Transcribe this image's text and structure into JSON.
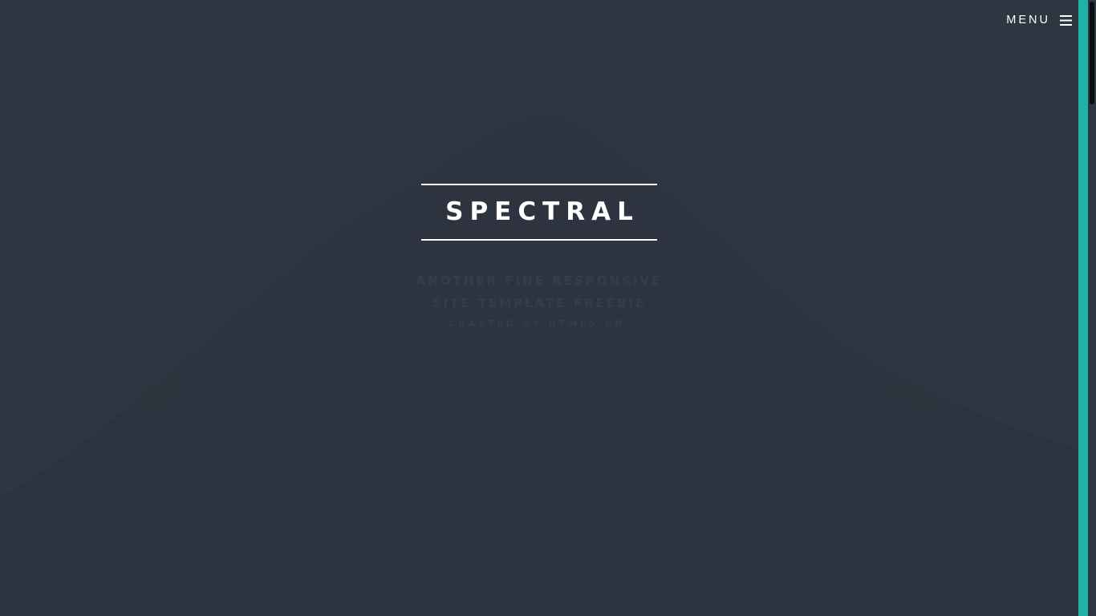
{
  "header": {
    "menu_label": "MENU",
    "menu_icon": "hamburger-icon"
  },
  "banner": {
    "title": "SPECTRAL",
    "tagline_line1": "ANOTHER FINE RESPONSIVE",
    "tagline_line2": "SITE TEMPLATE FREEBIE",
    "tagline_line3": "CRAFTED BY HTML5 UP."
  },
  "colors": {
    "background": "#2e3641",
    "accent": "#21b2a6",
    "text": "#ffffff",
    "scroll_thumb": "#0b0d10"
  }
}
